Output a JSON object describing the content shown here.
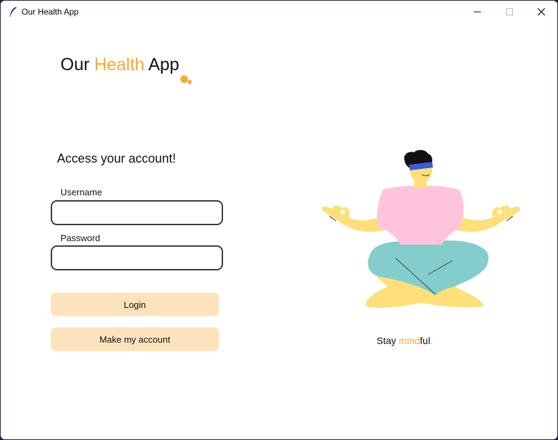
{
  "window": {
    "title": "Our Health App",
    "controls": {
      "minimize": "minimize",
      "maximize": "maximize",
      "close": "close"
    }
  },
  "logo": {
    "part1": "Our ",
    "part2": "Health",
    "part3": " App"
  },
  "form": {
    "heading": "Access your account!",
    "username_label": "Username",
    "username_value": "",
    "password_label": "Password",
    "password_value": ""
  },
  "buttons": {
    "login": "Login",
    "make_account": "Make my account"
  },
  "tagline": {
    "part1": "Stay ",
    "part2": "mind",
    "part3": "ful",
    "part4": "."
  },
  "colors": {
    "accent": "#f5a93a",
    "button_bg": "#fde3bd",
    "shirt": "#ffc4dc",
    "pants": "#85cccc",
    "skin": "#fde07a",
    "headband": "#3b5bd9"
  },
  "icons": {
    "app": "feather-icon",
    "minimize": "minimize-icon",
    "maximize": "maximize-icon",
    "close": "close-icon"
  }
}
